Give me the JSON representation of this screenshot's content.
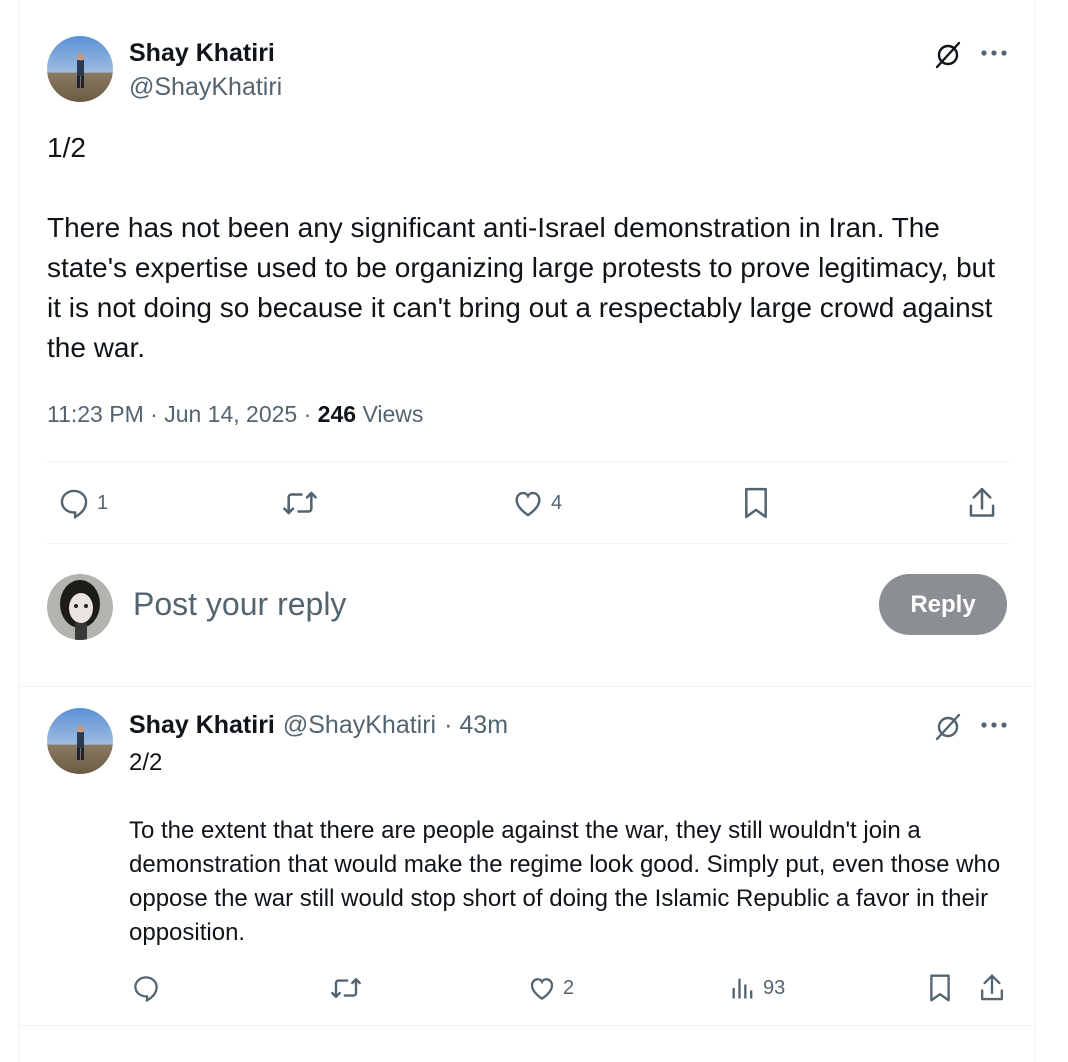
{
  "main_post": {
    "author_name": "Shay Khatiri",
    "author_handle": "@ShayKhatiri",
    "thread_index": "1/2",
    "text": "There has not been any significant anti-Israel demonstration in Iran. The state's expertise used to be organizing large protests to prove legitimacy, but it is not doing so because it can't bring out a respectably large crowd against the war.",
    "time": "11:23 PM",
    "separator": "·",
    "date": "Jun 14, 2025",
    "views_count": "246",
    "views_label": "Views",
    "reply_count": "1",
    "like_count": "4"
  },
  "composer": {
    "placeholder": "Post your reply",
    "reply_button": "Reply"
  },
  "reply_post": {
    "author_name": "Shay Khatiri",
    "author_handle": "@ShayKhatiri",
    "age": "· 43m",
    "thread_index": "2/2",
    "text": "To the extent that there are people against the war, they still wouldn't join a demonstration that would make the regime look good. Simply put, even those who oppose the war still would stop short of doing the Islamic Republic a favor in their opposition.",
    "like_count": "2",
    "views_count": "93"
  },
  "icons": [
    "grok-icon",
    "more-icon",
    "reply-icon",
    "retweet-icon",
    "like-icon",
    "bookmark-icon",
    "share-icon",
    "views-icon"
  ],
  "colors": {
    "text": "#0f1419",
    "muted": "#536471",
    "divider": "#eff3f4",
    "reply_button_bg": "#8b8f93"
  }
}
